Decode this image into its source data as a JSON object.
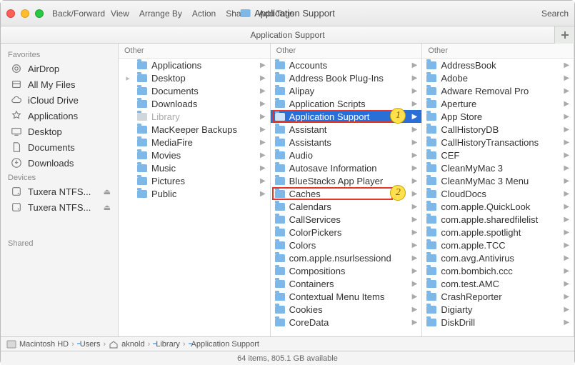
{
  "window": {
    "title": "Application Support"
  },
  "toolbar": {
    "back_forward": "Back/Forward",
    "menus": [
      "View",
      "Arrange By",
      "Action",
      "Share",
      "Add Tags"
    ],
    "search": "Search"
  },
  "pathheader": {
    "label": "Application Support"
  },
  "sidebar": {
    "sections": [
      {
        "title": "Favorites",
        "items": [
          {
            "icon": "airdrop",
            "label": "AirDrop"
          },
          {
            "icon": "allfiles",
            "label": "All My Files"
          },
          {
            "icon": "icloud",
            "label": "iCloud Drive"
          },
          {
            "icon": "apps",
            "label": "Applications"
          },
          {
            "icon": "desktop",
            "label": "Desktop"
          },
          {
            "icon": "documents",
            "label": "Documents"
          },
          {
            "icon": "downloads",
            "label": "Downloads"
          }
        ]
      },
      {
        "title": "Devices",
        "items": [
          {
            "icon": "disk",
            "label": "Tuxera NTFS...",
            "eject": true
          },
          {
            "icon": "disk",
            "label": "Tuxera NTFS...",
            "eject": true
          }
        ]
      },
      {
        "title": "Shared",
        "items": []
      }
    ]
  },
  "columns": [
    {
      "header": "Other",
      "items": [
        {
          "label": "Applications"
        },
        {
          "label": "Desktop",
          "expand": true
        },
        {
          "label": "Documents"
        },
        {
          "label": "Downloads"
        },
        {
          "label": "Library",
          "dim": true,
          "selected_path": true
        },
        {
          "label": "MacKeeper Backups"
        },
        {
          "label": "MediaFire"
        },
        {
          "label": "Movies"
        },
        {
          "label": "Music"
        },
        {
          "label": "Pictures"
        },
        {
          "label": "Public"
        }
      ]
    },
    {
      "header": "Other",
      "items": [
        {
          "label": "Accounts"
        },
        {
          "label": "Address Book Plug-Ins"
        },
        {
          "label": "Alipay"
        },
        {
          "label": "Application Scripts"
        },
        {
          "label": "Application Support",
          "selected": true
        },
        {
          "label": "Assistant"
        },
        {
          "label": "Assistants"
        },
        {
          "label": "Audio"
        },
        {
          "label": "Autosave Information"
        },
        {
          "label": "BlueStacks App Player"
        },
        {
          "label": "Caches"
        },
        {
          "label": "Calendars"
        },
        {
          "label": "CallServices"
        },
        {
          "label": "ColorPickers"
        },
        {
          "label": "Colors"
        },
        {
          "label": "com.apple.nsurlsessiond"
        },
        {
          "label": "Compositions"
        },
        {
          "label": "Containers"
        },
        {
          "label": "Contextual Menu Items"
        },
        {
          "label": "Cookies"
        },
        {
          "label": "CoreData"
        }
      ]
    },
    {
      "header": "Other",
      "items": [
        {
          "label": "AddressBook"
        },
        {
          "label": "Adobe"
        },
        {
          "label": "Adware Removal Pro"
        },
        {
          "label": "Aperture"
        },
        {
          "label": "App Store"
        },
        {
          "label": "CallHistoryDB"
        },
        {
          "label": "CallHistoryTransactions"
        },
        {
          "label": "CEF"
        },
        {
          "label": "CleanMyMac 3"
        },
        {
          "label": "CleanMyMac 3 Menu"
        },
        {
          "label": "CloudDocs"
        },
        {
          "label": "com.apple.QuickLook"
        },
        {
          "label": "com.apple.sharedfilelist"
        },
        {
          "label": "com.apple.spotlight"
        },
        {
          "label": "com.apple.TCC"
        },
        {
          "label": "com.avg.Antivirus"
        },
        {
          "label": "com.bombich.ccc"
        },
        {
          "label": "com.test.AMC"
        },
        {
          "label": "CrashReporter"
        },
        {
          "label": "Digiarty"
        },
        {
          "label": "DiskDrill"
        }
      ]
    }
  ],
  "annotations": [
    {
      "num": "1",
      "col": 1,
      "row": 4
    },
    {
      "num": "2",
      "col": 1,
      "row": 10
    }
  ],
  "pathbar": [
    {
      "icon": "hd",
      "label": "Macintosh HD"
    },
    {
      "icon": "folder",
      "label": "Users"
    },
    {
      "icon": "home",
      "label": "aknold"
    },
    {
      "icon": "folder",
      "label": "Library"
    },
    {
      "icon": "folder",
      "label": "Application Support"
    }
  ],
  "status": "64 items, 805.1 GB available"
}
